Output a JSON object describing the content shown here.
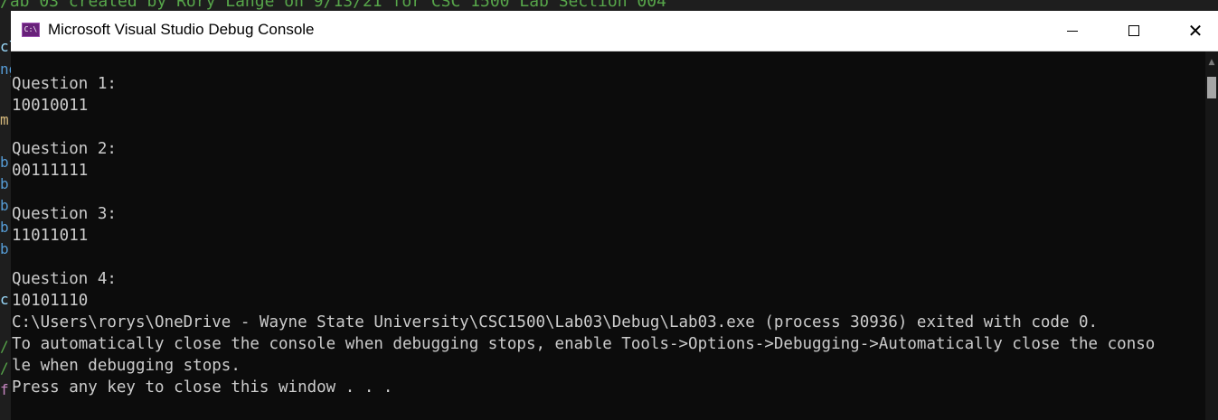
{
  "editor": {
    "top_comment": "/ab 03 created by Rory Lange on 9/13/21 for CSC 1500 Lab Section 004",
    "left_gutter_chars": [
      {
        "text": "cl",
        "color": "#9cdcfe"
      },
      {
        "text": "ng",
        "color": "#569cd6"
      },
      {
        "text": "m",
        "color": "#d7ba7d"
      },
      {
        "text": "b",
        "color": "#569cd6"
      },
      {
        "text": "b",
        "color": "#569cd6"
      },
      {
        "text": "b",
        "color": "#569cd6"
      },
      {
        "text": "b",
        "color": "#569cd6"
      },
      {
        "text": "b",
        "color": "#569cd6"
      },
      {
        "text": "c",
        "color": "#9cdcfe"
      },
      {
        "text": "/",
        "color": "#57a64a"
      },
      {
        "text": "/",
        "color": "#57a64a"
      },
      {
        "text": "f",
        "color": "#c586c0"
      }
    ]
  },
  "window": {
    "icon_label": "C:\\",
    "title": "Microsoft Visual Studio Debug Console",
    "minimize_icon": "minimize-icon",
    "maximize_icon": "maximize-icon",
    "close_icon": "close-icon",
    "close_glyph": "✕"
  },
  "console": {
    "lines": [
      "Question 1:",
      "10010011",
      "",
      "Question 2:",
      "00111111",
      "",
      "Question 3:",
      "11011011",
      "",
      "Question 4:",
      "10101110",
      "C:\\Users\\rorys\\OneDrive - Wayne State University\\CSC1500\\Lab03\\Debug\\Lab03.exe (process 30936) exited with code 0.",
      "To automatically close the console when debugging stops, enable Tools->Options->Debugging->Automatically close the conso",
      "le when debugging stops.",
      "Press any key to close this window . . ."
    ],
    "text_color": "#cccccc",
    "background": "#0c0c0c"
  },
  "scrollbar": {
    "up_glyph": "▲"
  }
}
